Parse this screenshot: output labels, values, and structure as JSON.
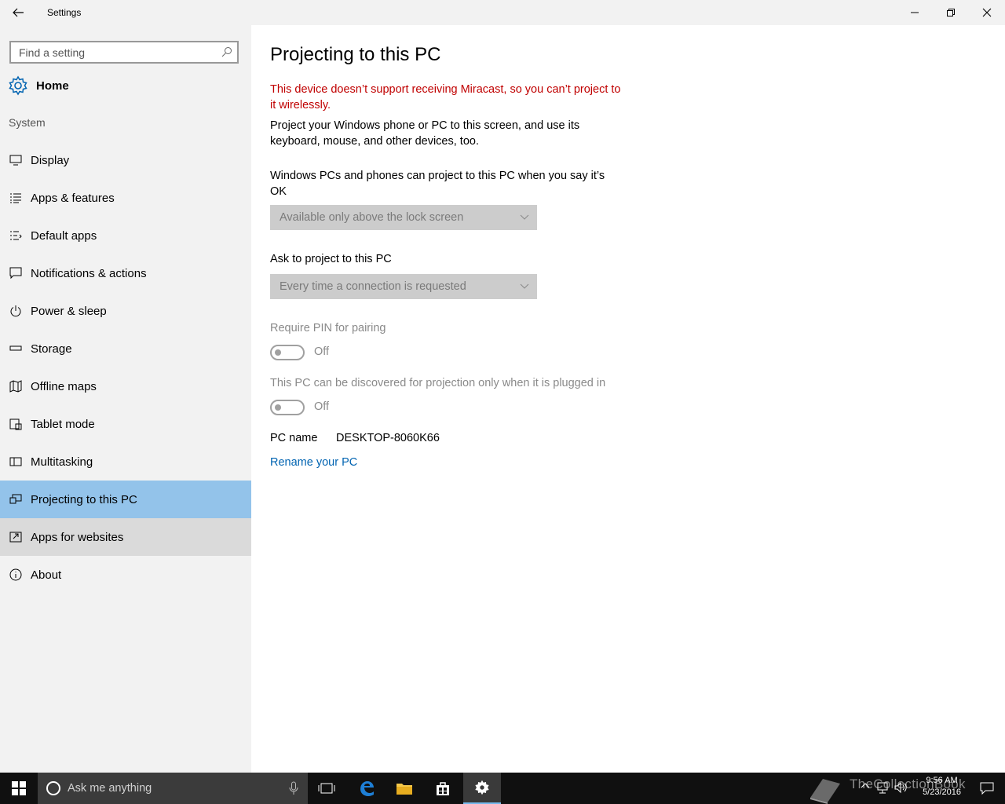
{
  "window": {
    "title": "Settings"
  },
  "sidebar": {
    "search_placeholder": "Find a setting",
    "home_label": "Home",
    "section_label": "System",
    "items": [
      {
        "label": "Display",
        "icon": "monitor-icon"
      },
      {
        "label": "Apps & features",
        "icon": "list-icon"
      },
      {
        "label": "Default apps",
        "icon": "default-list-icon"
      },
      {
        "label": "Notifications & actions",
        "icon": "message-icon"
      },
      {
        "label": "Power & sleep",
        "icon": "power-icon"
      },
      {
        "label": "Storage",
        "icon": "storage-icon"
      },
      {
        "label": "Offline maps",
        "icon": "map-icon"
      },
      {
        "label": "Tablet mode",
        "icon": "tablet-icon"
      },
      {
        "label": "Multitasking",
        "icon": "multitask-icon"
      },
      {
        "label": "Projecting to this PC",
        "icon": "project-icon"
      },
      {
        "label": "Apps for websites",
        "icon": "website-icon"
      },
      {
        "label": "About",
        "icon": "info-icon"
      }
    ],
    "active_item": "Projecting to this PC"
  },
  "main": {
    "title": "Projecting to this PC",
    "warning": "This device doesn’t support receiving Miracast, so you can’t project to it wirelessly.",
    "description": "Project your Windows phone or PC to this screen, and use its keyboard, mouse, and other devices, too.",
    "label_when": "Windows PCs and phones can project to this PC when you say it’s OK",
    "dropdown_when": "Available only above the lock screen",
    "label_ask": "Ask to project to this PC",
    "dropdown_ask": "Every time a connection is requested",
    "label_pin": "Require PIN for pairing",
    "toggle_pin": "Off",
    "label_plugged": "This PC can be discovered for projection only when it is plugged in",
    "toggle_plugged": "Off",
    "pc_name_label": "PC name",
    "pc_name_value": "DESKTOP-8060K66",
    "rename_link": "Rename your PC"
  },
  "taskbar": {
    "search_placeholder": "Ask me anything",
    "clock_time": "9:56 AM",
    "clock_date": "5/23/2016",
    "watermark": "TheCollectionBook"
  },
  "colors": {
    "accent": "#0063b1",
    "active_nav": "#93c3ea",
    "warning": "#c00000"
  }
}
